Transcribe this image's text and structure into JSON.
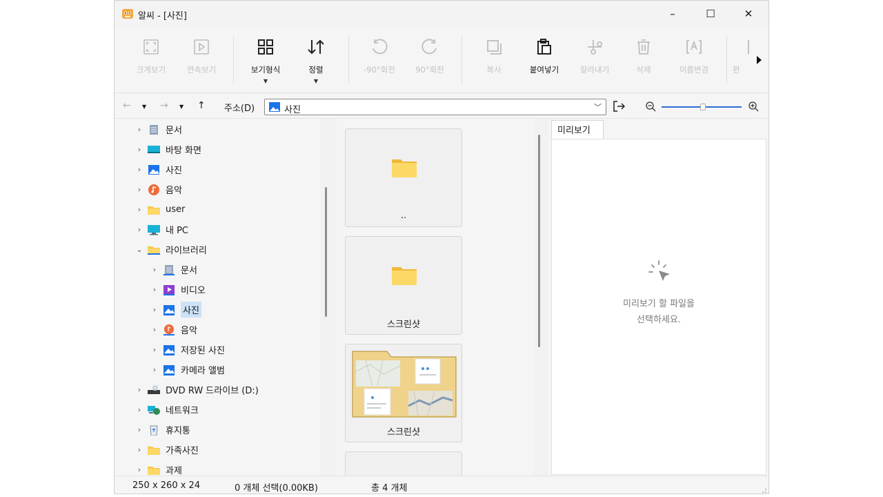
{
  "window": {
    "title": "알씨 - [사진]",
    "controls": {
      "minimize": "–",
      "maximize": "☐",
      "close": "✕"
    }
  },
  "toolbar": {
    "items": [
      {
        "label": "크게보기",
        "icon": "fullscreen-icon",
        "enabled": false
      },
      {
        "label": "연속보기",
        "icon": "slideshow-icon",
        "enabled": false
      },
      {
        "label": "보기형식",
        "icon": "grid-view-icon",
        "enabled": true,
        "dropdown": true
      },
      {
        "label": "정렬",
        "icon": "sort-icon",
        "enabled": true,
        "dropdown": true
      },
      {
        "label": "-90°회전",
        "icon": "rotate-left-icon",
        "enabled": false
      },
      {
        "label": "90°회전",
        "icon": "rotate-right-icon",
        "enabled": false
      },
      {
        "label": "복사",
        "icon": "copy-icon",
        "enabled": false
      },
      {
        "label": "붙여넣기",
        "icon": "paste-icon",
        "enabled": true
      },
      {
        "label": "잘라내기",
        "icon": "cut-icon",
        "enabled": false
      },
      {
        "label": "삭제",
        "icon": "delete-icon",
        "enabled": false
      },
      {
        "label": "이름변경",
        "icon": "rename-icon",
        "enabled": false
      },
      {
        "label": "편",
        "icon": "edit-icon",
        "enabled": false
      }
    ]
  },
  "addressbar": {
    "label": "주소(D)",
    "value": "사진"
  },
  "tree": {
    "items": [
      {
        "label": "문서",
        "icon": "document-icon",
        "level": 0,
        "expanded": false
      },
      {
        "label": "바탕 화면",
        "icon": "desktop-icon",
        "level": 0,
        "expanded": false
      },
      {
        "label": "사진",
        "icon": "pictures-icon",
        "level": 0,
        "expanded": false
      },
      {
        "label": "음악",
        "icon": "music-icon",
        "level": 0,
        "expanded": false
      },
      {
        "label": "user",
        "icon": "folder-icon",
        "level": 0,
        "expanded": false
      },
      {
        "label": "내 PC",
        "icon": "pc-icon",
        "level": 0,
        "expanded": false
      },
      {
        "label": "라이브러리",
        "icon": "folder-icon",
        "level": 0,
        "expanded": true
      },
      {
        "label": "문서",
        "icon": "document-icon",
        "level": 1,
        "expanded": false
      },
      {
        "label": "비디오",
        "icon": "video-icon",
        "level": 1,
        "expanded": false
      },
      {
        "label": "사진",
        "icon": "pictures-icon",
        "level": 1,
        "expanded": false,
        "selected": true
      },
      {
        "label": "음악",
        "icon": "music-icon",
        "level": 1,
        "expanded": false
      },
      {
        "label": "저장된 사진",
        "icon": "pictures-icon",
        "level": 1,
        "expanded": false
      },
      {
        "label": "카메라 앨범",
        "icon": "pictures-icon",
        "level": 1,
        "expanded": false
      },
      {
        "label": "DVD RW 드라이브 (D:)",
        "icon": "dvd-drive-icon",
        "level": 0,
        "expanded": false
      },
      {
        "label": "네트워크",
        "icon": "network-icon",
        "level": 0,
        "expanded": false
      },
      {
        "label": "휴지통",
        "icon": "recycle-bin-icon",
        "level": 0,
        "expanded": false
      },
      {
        "label": "가족사진",
        "icon": "folder-icon",
        "level": 0,
        "expanded": false
      },
      {
        "label": "과제",
        "icon": "folder-icon",
        "level": 0,
        "expanded": false
      }
    ]
  },
  "files": {
    "items": [
      {
        "label": "..",
        "kind": "parent-folder"
      },
      {
        "label": "스크린샷",
        "kind": "folder"
      },
      {
        "label": "스크린샷",
        "kind": "folder-with-thumbnails"
      }
    ]
  },
  "preview": {
    "tab_label": "미리보기",
    "message_line1": "미리보기 할 파일을",
    "message_line2": "선택하세요."
  },
  "status": {
    "thumb_size": "250 x 260 x 24",
    "selection": "0 개체 선택(0.00KB)",
    "total": "총 4 개체"
  },
  "colors": {
    "accent": "#2b6dd6",
    "folder": "#f7c948",
    "selection": "#cde1f7"
  }
}
